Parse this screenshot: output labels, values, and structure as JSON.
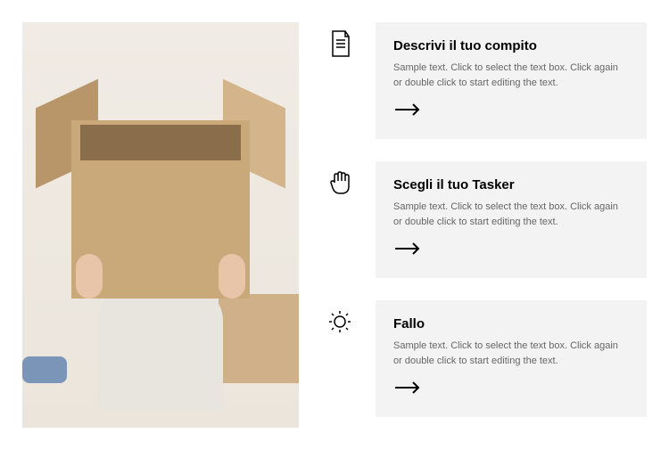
{
  "steps": [
    {
      "title": "Descrivi il tuo compito",
      "description": "Sample text. Click to select the text box. Click again or double click to start editing the text."
    },
    {
      "title": "Scegli il tuo Tasker",
      "description": "Sample text. Click to select the text box. Click again or double click to start editing the text."
    },
    {
      "title": "Fallo",
      "description": "Sample text. Click to select the text box. Click again or double click to start editing the text."
    }
  ]
}
